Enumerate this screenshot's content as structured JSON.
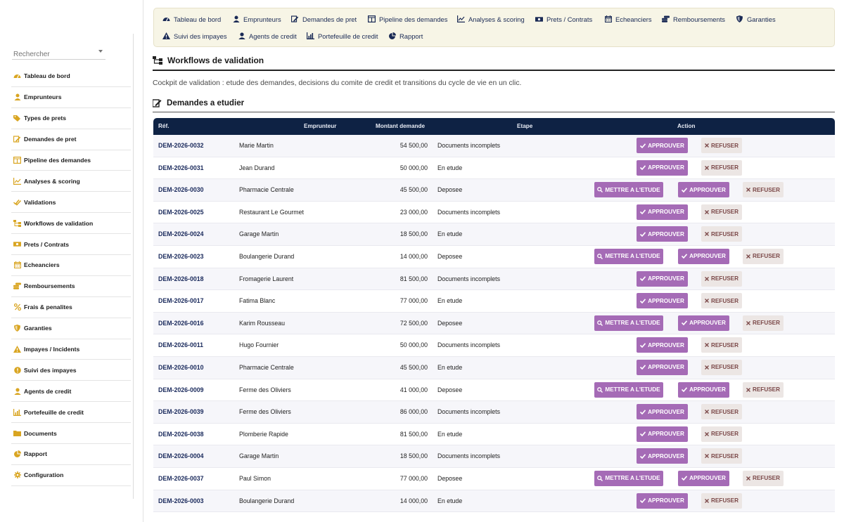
{
  "sidebar": {
    "search_placeholder": "Rechercher",
    "items": [
      {
        "label": "Tableau de bord",
        "icon": "dashboard-icon"
      },
      {
        "label": "Emprunteurs",
        "icon": "user-icon"
      },
      {
        "label": "Types de prets",
        "icon": "tags-icon"
      },
      {
        "label": "Demandes de pret",
        "icon": "edit-icon"
      },
      {
        "label": "Pipeline des demandes",
        "icon": "columns-icon"
      },
      {
        "label": "Analyses & scoring",
        "icon": "chart-icon"
      },
      {
        "label": "Validations",
        "icon": "check-double-icon"
      },
      {
        "label": "Workflows de validation",
        "icon": "sitemap-icon"
      },
      {
        "label": "Prets / Contrats",
        "icon": "money-icon"
      },
      {
        "label": "Echeanciers",
        "icon": "calendar-icon"
      },
      {
        "label": "Remboursements",
        "icon": "coins-icon"
      },
      {
        "label": "Frais & penalites",
        "icon": "percent-icon"
      },
      {
        "label": "Garanties",
        "icon": "shield-icon"
      },
      {
        "label": "Impayes / Incidents",
        "icon": "warning-icon"
      },
      {
        "label": "Suivi des impayes",
        "icon": "alert-circle-icon"
      },
      {
        "label": "Agents de credit",
        "icon": "agent-icon"
      },
      {
        "label": "Portefeuille de credit",
        "icon": "portfolio-chart-icon"
      },
      {
        "label": "Documents",
        "icon": "folder-icon"
      },
      {
        "label": "Rapport",
        "icon": "pie-chart-icon"
      },
      {
        "label": "Configuration",
        "icon": "gear-icon"
      }
    ]
  },
  "topnav": {
    "items": [
      {
        "label": "Tableau de bord",
        "icon": "dashboard-icon"
      },
      {
        "label": "Emprunteurs",
        "icon": "user-icon"
      },
      {
        "label": "Demandes de pret",
        "icon": "edit-icon"
      },
      {
        "label": "Pipeline des demandes",
        "icon": "columns-icon"
      },
      {
        "label": "Analyses & scoring",
        "icon": "chart-icon"
      },
      {
        "label": "Prets / Contrats",
        "icon": "money-icon"
      },
      {
        "label": "Echeanciers",
        "icon": "calendar-icon"
      },
      {
        "label": "Remboursements",
        "icon": "coins-icon"
      },
      {
        "label": "Garanties",
        "icon": "shield-icon"
      },
      {
        "label": "Suivi des impayes",
        "icon": "warning-icon"
      },
      {
        "label": "Agents de credit",
        "icon": "agent-icon"
      },
      {
        "label": "Portefeuille de credit",
        "icon": "portfolio-chart-icon"
      },
      {
        "label": "Rapport",
        "icon": "pie-chart-icon"
      }
    ]
  },
  "page": {
    "title": "Workflows de validation",
    "subtitle": "Cockpit de validation : etude des demandes, decisions du comite de credit et transitions du cycle de vie en un clic.",
    "section_title": "Demandes a etudier"
  },
  "table": {
    "columns": {
      "ref": "Réf.",
      "emprunteur": "Emprunteur",
      "montant": "Montant demande",
      "etape": "Etape",
      "action": "Action"
    },
    "actions": {
      "approve": "APPROUVER",
      "refuse": "REFUSER",
      "study": "METTRE A L'ETUDE"
    },
    "rows": [
      {
        "ref": "DEM-2026-0032",
        "emprunteur": "Marie Martin",
        "montant": "54 500,00",
        "etape": "Documents incomplets",
        "study": false
      },
      {
        "ref": "DEM-2026-0031",
        "emprunteur": "Jean Durand",
        "montant": "50 000,00",
        "etape": "En etude",
        "study": false
      },
      {
        "ref": "DEM-2026-0030",
        "emprunteur": "Pharmacie Centrale",
        "montant": "45 500,00",
        "etape": "Deposee",
        "study": true
      },
      {
        "ref": "DEM-2026-0025",
        "emprunteur": "Restaurant Le Gourmet",
        "montant": "23 000,00",
        "etape": "Documents incomplets",
        "study": false
      },
      {
        "ref": "DEM-2026-0024",
        "emprunteur": "Garage Martin",
        "montant": "18 500,00",
        "etape": "En etude",
        "study": false
      },
      {
        "ref": "DEM-2026-0023",
        "emprunteur": "Boulangerie Durand",
        "montant": "14 000,00",
        "etape": "Deposee",
        "study": true
      },
      {
        "ref": "DEM-2026-0018",
        "emprunteur": "Fromagerie Laurent",
        "montant": "81 500,00",
        "etape": "Documents incomplets",
        "study": false
      },
      {
        "ref": "DEM-2026-0017",
        "emprunteur": "Fatima Blanc",
        "montant": "77 000,00",
        "etape": "En etude",
        "study": false
      },
      {
        "ref": "DEM-2026-0016",
        "emprunteur": "Karim Rousseau",
        "montant": "72 500,00",
        "etape": "Deposee",
        "study": true
      },
      {
        "ref": "DEM-2026-0011",
        "emprunteur": "Hugo Fournier",
        "montant": "50 000,00",
        "etape": "Documents incomplets",
        "study": false
      },
      {
        "ref": "DEM-2026-0010",
        "emprunteur": "Pharmacie Centrale",
        "montant": "45 500,00",
        "etape": "En etude",
        "study": false
      },
      {
        "ref": "DEM-2026-0009",
        "emprunteur": "Ferme des Oliviers",
        "montant": "41 000,00",
        "etape": "Deposee",
        "study": true
      },
      {
        "ref": "DEM-2026-0039",
        "emprunteur": "Ferme des Oliviers",
        "montant": "86 000,00",
        "etape": "Documents incomplets",
        "study": false
      },
      {
        "ref": "DEM-2026-0038",
        "emprunteur": "Plomberie Rapide",
        "montant": "81 500,00",
        "etape": "En etude",
        "study": false
      },
      {
        "ref": "DEM-2026-0004",
        "emprunteur": "Garage Martin",
        "montant": "18 500,00",
        "etape": "Documents incomplets",
        "study": false
      },
      {
        "ref": "DEM-2026-0037",
        "emprunteur": "Paul Simon",
        "montant": "77 000,00",
        "etape": "Deposee",
        "study": true
      },
      {
        "ref": "DEM-2026-0003",
        "emprunteur": "Boulangerie Durand",
        "montant": "14 000,00",
        "etape": "En etude",
        "study": false
      }
    ]
  },
  "colors": {
    "header_bg": "#0e2244",
    "accent_purple": "#a56bb6",
    "refuse_bg": "#ece6e4",
    "topnav_bg": "#f7f5e6",
    "sidebar_icon": "#d9a521"
  }
}
